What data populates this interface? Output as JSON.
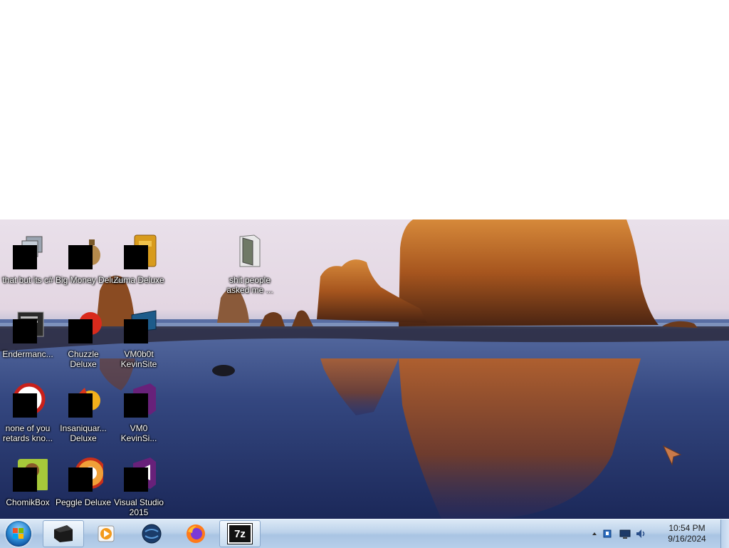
{
  "desktop": {
    "icons": [
      {
        "label": "that but its c#",
        "icon": "stacked-windows-icon"
      },
      {
        "label": "Big Money Deluxe",
        "icon": "money-bag-icon"
      },
      {
        "label": "Zuma Deluxe",
        "icon": "zuma-idol-icon"
      },
      {
        "label": "shit people asked me ...",
        "icon": "folder-icon"
      },
      {
        "label": "Endermanc...",
        "icon": "terminal-window-icon"
      },
      {
        "label": "Chuzzle Deluxe",
        "icon": "chuzzle-icon"
      },
      {
        "label": "VM0b0t KevinSite",
        "icon": "monitor-icon"
      },
      {
        "label": "none of you retards kno...",
        "icon": "pie-chart-icon"
      },
      {
        "label": "Insaniquar... Deluxe",
        "icon": "fish-icon"
      },
      {
        "label": "VM0 KevinSi...",
        "icon": "visual-studio-icon"
      },
      {
        "label": "ChomikBox",
        "icon": "hamster-icon"
      },
      {
        "label": "Peggle Deluxe",
        "icon": "peggle-icon"
      },
      {
        "label": "Visual Studio 2015",
        "icon": "visual-studio-icon"
      }
    ]
  },
  "taskbar": {
    "start_label": "Start",
    "pinned": [
      {
        "name": "terminal-app",
        "icon": "black-box-icon",
        "active": true
      },
      {
        "name": "media-player",
        "icon": "media-player-icon",
        "active": false
      },
      {
        "name": "globe-app",
        "icon": "globe-icon",
        "active": false
      },
      {
        "name": "firefox",
        "icon": "firefox-icon",
        "active": false
      },
      {
        "name": "7zip",
        "icon": "7z-icon",
        "label": "7z",
        "active": true
      }
    ],
    "tray": {
      "icons": [
        "show-hidden-icons-chevron",
        "network-icon",
        "display-icon",
        "volume-icon"
      ],
      "time": "10:54 PM",
      "date": "9/16/2024"
    }
  },
  "colors": {
    "taskbar": "#bcd2ea",
    "sky": "#e9e0ea",
    "sea": "#283a73",
    "rock": "#c96f24"
  }
}
